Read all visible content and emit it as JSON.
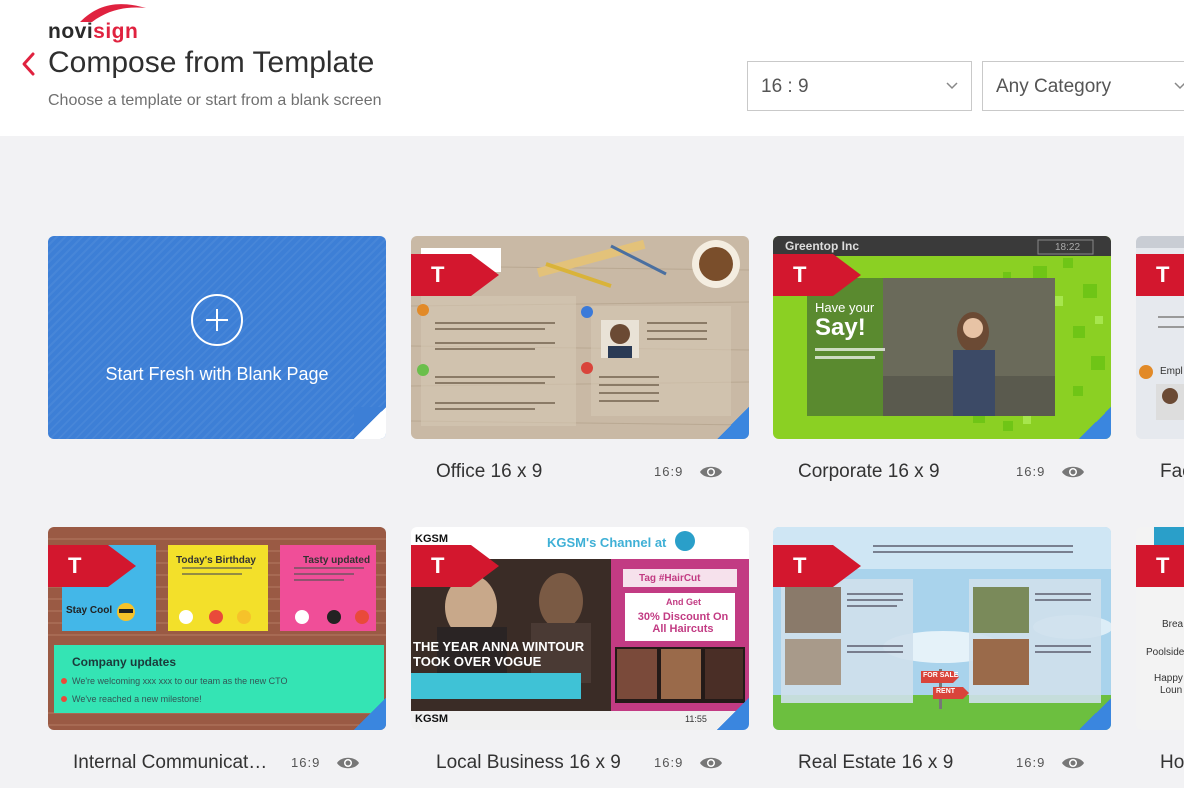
{
  "header": {
    "logo": {
      "text_a": "novi",
      "text_b": "sign"
    },
    "title": "Compose from Template",
    "subtitle": "Choose a template or start from a blank screen",
    "ratio_select": {
      "value": "16 : 9"
    },
    "category_select": {
      "value": "Any Category"
    }
  },
  "blank_card": {
    "label": "Start Fresh with Blank Page"
  },
  "templates": [
    {
      "name": "Office 16 x 9",
      "ratio": "16:9"
    },
    {
      "name": "Corporate 16 x 9",
      "ratio": "16:9"
    },
    {
      "name": "Fac",
      "ratio": ""
    },
    {
      "name": "Internal Communicat…",
      "ratio": "16:9"
    },
    {
      "name": "Local Business 16 x 9",
      "ratio": "16:9"
    },
    {
      "name": "Real Estate 16 x 9",
      "ratio": "16:9"
    },
    {
      "name": "Ho",
      "ratio": ""
    }
  ],
  "thumb_text": {
    "corporate_brand": "Greentop Inc",
    "corporate_time": "18:22",
    "corporate_line1": "Have your",
    "corporate_line2": "Say!",
    "internal_b1": "Today's Birthday",
    "internal_b2": "Tasty updated",
    "internal_b3": "Stay Cool",
    "internal_updates": "Company updates",
    "internal_u1": "We're welcoming xxx xxx to our team as the new CTO",
    "internal_u2": "We've reached a new milestone!",
    "local_brand": "KGSM",
    "local_channel": "KGSM's Channel at",
    "local_headline": "THE YEAR ANNA WINTOUR TOOK OVER VOGUE",
    "local_offer": "30% Discount On All Haircuts",
    "local_tag": "Tag #HairCut",
    "local_andget": "And Get",
    "local_brand2": "KGSM",
    "local_time": "11:55",
    "real_sale": "FOR SALE",
    "real_rent": "RENT",
    "partial_text": "Brea",
    "partial_text2": "Poolside",
    "partial_text3": "Happy",
    "partial_text4": "Loun",
    "partial_text5": "Empl"
  },
  "colors": {
    "accent": "#e0223f",
    "blank_card": "#3d7fd6",
    "corporate": "#8bd023"
  },
  "icons": [
    "chevron-left-icon",
    "chevron-down-icon",
    "plus-icon",
    "eye-icon",
    "t-ribbon-icon"
  ]
}
